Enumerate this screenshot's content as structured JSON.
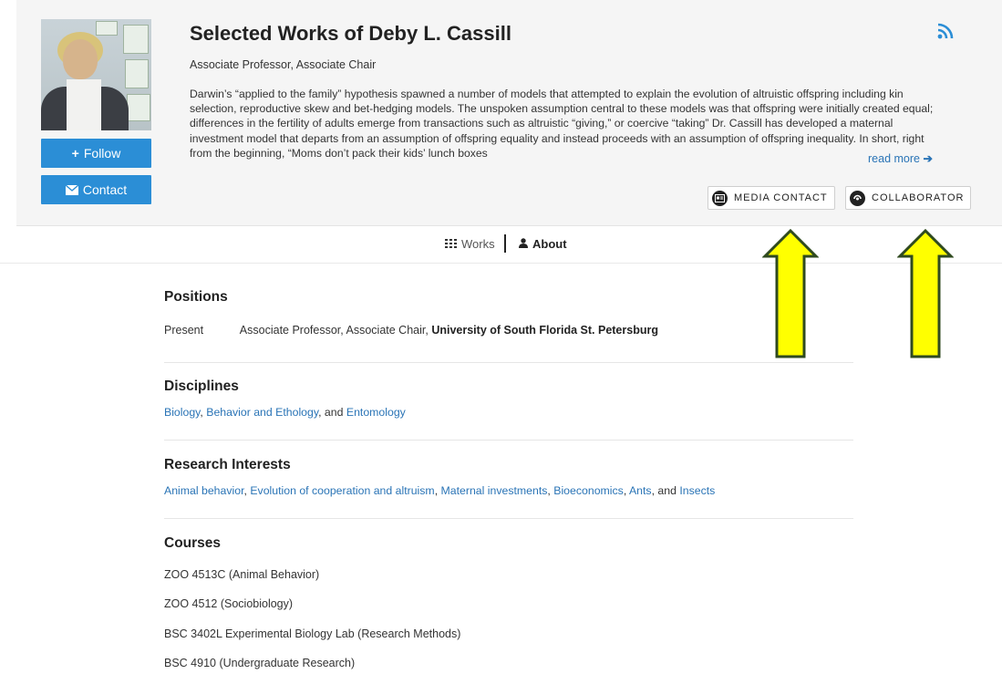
{
  "profile": {
    "name": "Selected Works of Deby L. Cassill",
    "title": "Associate Professor, Associate Chair",
    "bio": "Darwin’s “applied to the family” hypothesis spawned a number of models that attempted to explain the evolution of altruistic offspring including kin selection, reproductive skew and bet-hedging models. The unspoken assumption central to these models was that offspring were initially created equal; differences in the fertility of adults emerge from transactions such as altruistic “giving,” or coercive “taking” Dr. Cassill has developed a maternal investment model that departs from an assumption of offspring equality and instead proceeds with an assumption of offspring inequality. In short, right from the beginning, “Moms don’t pack their kids’ lunch boxes",
    "read_more": "read more",
    "follow_label": "Follow",
    "contact_label": "Contact",
    "media_contact_label": "MEDIA CONTACT",
    "collaborator_label": "COLLABORATOR"
  },
  "tabs": {
    "works": "Works",
    "about": "About"
  },
  "positions": {
    "heading": "Positions",
    "items": [
      {
        "period": "Present",
        "role": "Associate Professor, Associate Chair,",
        "org": "University of South Florida St. Petersburg"
      }
    ]
  },
  "disciplines": {
    "heading": "Disciplines",
    "items": [
      "Biology",
      "Behavior and Ethology",
      "Entomology"
    ],
    "sep1": ", ",
    "sep2": ", and "
  },
  "research": {
    "heading": "Research Interests",
    "items": [
      "Animal behavior",
      "Evolution of cooperation and altruism",
      "Maternal investments",
      "Bioeconomics",
      "Ants",
      "Insects"
    ],
    "sep": ", ",
    "sep_last": ", and "
  },
  "courses": {
    "heading": "Courses",
    "items": [
      "ZOO 4513C (Animal Behavior)",
      "ZOO 4512 (Sociobiology)",
      "BSC 3402L Experimental Biology Lab (Research Methods)",
      "BSC 4910 (Undergraduate Research)"
    ]
  },
  "colors": {
    "accent": "#2b8ed6",
    "link": "#2a74b6",
    "annotation_arrow": "#ffff00",
    "annotation_outline": "#2f4a1f"
  },
  "icons": {
    "rss": "rss-icon",
    "follow": "plus-icon",
    "contact": "envelope-icon",
    "works": "grid-icon",
    "about": "user-icon",
    "media": "id-card-icon",
    "collab": "swirl-icon",
    "readmore": "arrow-right-icon"
  }
}
